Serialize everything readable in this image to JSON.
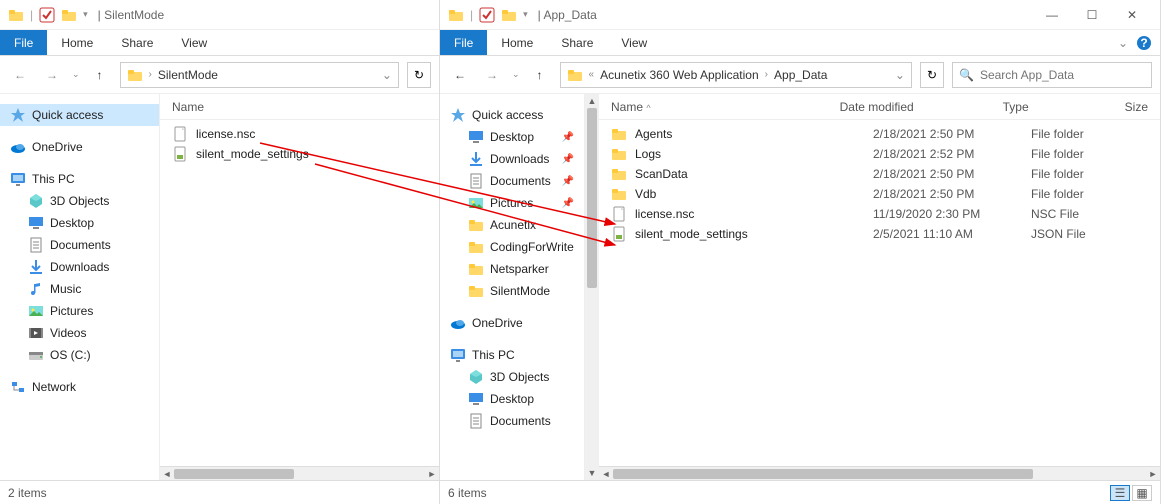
{
  "left": {
    "title": "SilentMode",
    "ribbon": {
      "file": "File",
      "home": "Home",
      "share": "Share",
      "view": "View"
    },
    "breadcrumb": "SilentMode",
    "nav": {
      "quick_access": "Quick access",
      "onedrive": "OneDrive",
      "this_pc": "This PC",
      "items": [
        "3D Objects",
        "Desktop",
        "Documents",
        "Downloads",
        "Music",
        "Pictures",
        "Videos",
        "OS (C:)"
      ],
      "network": "Network"
    },
    "columns": {
      "name": "Name"
    },
    "files": [
      {
        "name": "license.nsc"
      },
      {
        "name": "silent_mode_settings"
      }
    ],
    "status": "2 items"
  },
  "right": {
    "title": "App_Data",
    "ribbon": {
      "file": "File",
      "home": "Home",
      "share": "Share",
      "view": "View"
    },
    "breadcrumb": {
      "seg1": "Acunetix 360 Web Application",
      "seg2": "App_Data"
    },
    "search_placeholder": "Search App_Data",
    "nav": {
      "quick_access": "Quick access",
      "desktop": "Desktop",
      "downloads": "Downloads",
      "documents": "Documents",
      "pictures": "Pictures",
      "acunetix": "Acunetix",
      "codingforwriters": "CodingForWrite",
      "netsparker": "Netsparker",
      "silentmode": "SilentMode",
      "onedrive": "OneDrive",
      "this_pc": "This PC",
      "pc_items": [
        "3D Objects",
        "Desktop",
        "Documents"
      ]
    },
    "columns": {
      "name": "Name",
      "date": "Date modified",
      "type": "Type",
      "size": "Size"
    },
    "files": [
      {
        "name": "Agents",
        "date": "2/18/2021 2:50 PM",
        "type": "File folder"
      },
      {
        "name": "Logs",
        "date": "2/18/2021 2:52 PM",
        "type": "File folder"
      },
      {
        "name": "ScanData",
        "date": "2/18/2021 2:50 PM",
        "type": "File folder"
      },
      {
        "name": "Vdb",
        "date": "2/18/2021 2:50 PM",
        "type": "File folder"
      },
      {
        "name": "license.nsc",
        "date": "11/19/2020 2:30 PM",
        "type": "NSC File"
      },
      {
        "name": "silent_mode_settings",
        "date": "2/5/2021 11:10 AM",
        "type": "JSON File"
      }
    ],
    "status": "6 items"
  }
}
